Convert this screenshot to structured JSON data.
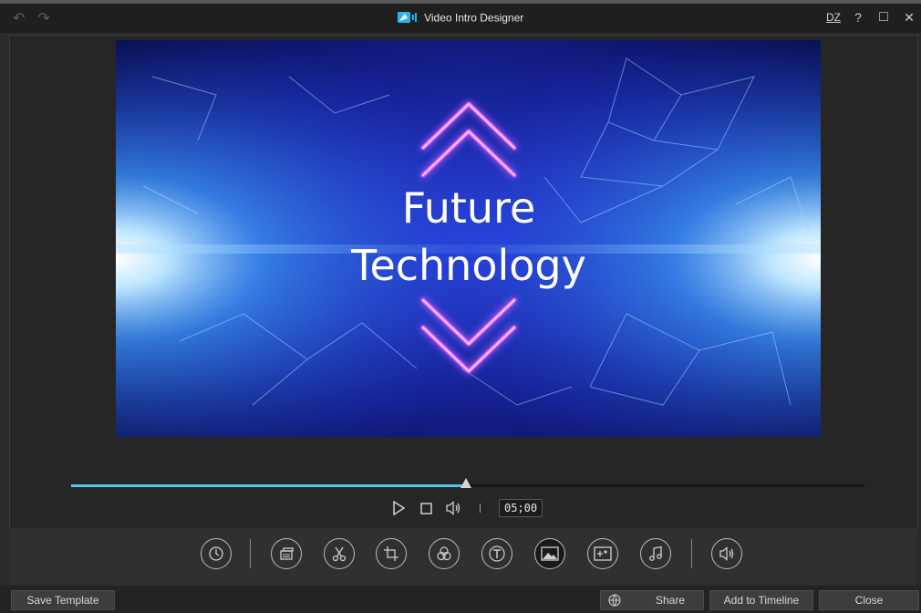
{
  "window": {
    "title": "Video Intro Designer",
    "nav": {
      "undo_icon": "undo-icon",
      "redo_icon": "redo-icon"
    },
    "controls": {
      "dz": "DZ",
      "help": "?",
      "maximize": "□",
      "close": "✕"
    }
  },
  "preview": {
    "title_line1": "Future",
    "title_line2": "Technology",
    "accent_color": "#c040ff",
    "glow_color": "#3fa0ff"
  },
  "playback": {
    "progress": 0.498,
    "timecode": "05;00",
    "play_icon": "play-icon",
    "stop_icon": "stop-icon",
    "volume_icon": "volume-icon"
  },
  "toolbar": {
    "tools": [
      {
        "name": "duration-tool",
        "icon": "clock-icon"
      },
      {
        "name": "background-tool",
        "icon": "layers-icon"
      },
      {
        "name": "trim-tool",
        "icon": "scissors-icon"
      },
      {
        "name": "crop-tool",
        "icon": "crop-icon"
      },
      {
        "name": "particle-tool",
        "icon": "circles-icon"
      },
      {
        "name": "title-tool",
        "icon": "text-icon"
      },
      {
        "name": "image-tool",
        "icon": "image-icon"
      },
      {
        "name": "effect-tool",
        "icon": "sparkle-icon"
      },
      {
        "name": "music-tool",
        "icon": "music-note-icon"
      },
      {
        "name": "audio-tool",
        "icon": "speaker-icon"
      }
    ]
  },
  "bottom": {
    "save_template": "Save Template",
    "share": "Share",
    "add_to_timeline": "Add to Timeline",
    "close": "Close"
  }
}
